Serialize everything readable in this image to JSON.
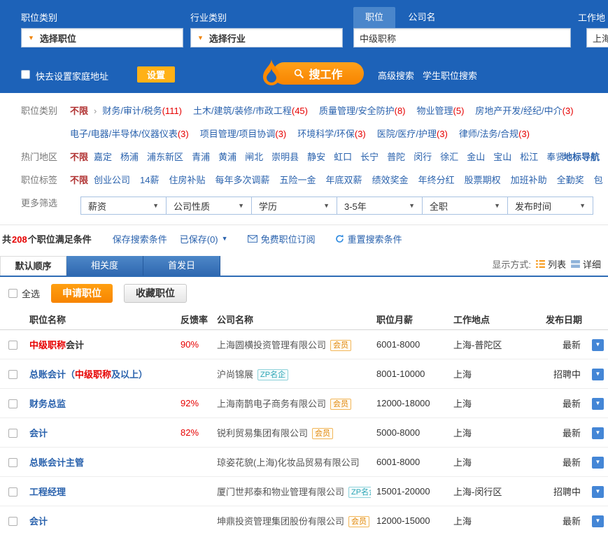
{
  "colors": {
    "header_blue": "#1d62b8",
    "accent_orange": "#ff9000",
    "highlight_red": "#e60000",
    "link_blue": "#2a62ad",
    "badge_member_orange": "#e0870a",
    "badge_zp_teal": "#2aa5b5"
  },
  "header": {
    "job_category_label": "职位类别",
    "industry_category_label": "行业类别",
    "work_location_label": "工作地",
    "job_select_text": "选择职位",
    "industry_select_text": "选择行业",
    "keyword_tabs": {
      "position": "职位",
      "company": "公司名"
    },
    "keyword_value": "中级职称",
    "location_value": "上海",
    "home_address_text": "快去设置家庭地址",
    "settings_button": "设置",
    "search_button": "搜工作",
    "advanced_search_link": "高级搜索",
    "student_search_link": "学生职位搜索"
  },
  "filters": {
    "job_category": {
      "label": "职位类别",
      "any": "不限",
      "rows": [
        [
          {
            "name": "财务/审计/税务",
            "count": "(111)"
          },
          {
            "name": "土木/建筑/装修/市政工程",
            "count": "(45)"
          },
          {
            "name": "质量管理/安全防护",
            "count": "(8)"
          },
          {
            "name": "物业管理",
            "count": "(5)"
          },
          {
            "name": "房地产开发/经纪/中介",
            "count": "(3)"
          }
        ],
        [
          {
            "name": "电子/电器/半导体/仪器仪表",
            "count": "(3)"
          },
          {
            "name": "项目管理/项目协调",
            "count": "(3)"
          },
          {
            "name": "环境科学/环保",
            "count": "(3)"
          },
          {
            "name": "医院/医疗/护理",
            "count": "(3)"
          },
          {
            "name": "律师/法务/合规",
            "count": "(3)"
          }
        ]
      ]
    },
    "hot_area": {
      "label": "热门地区",
      "any": "不限",
      "areas": [
        "嘉定",
        "杨浦",
        "浦东新区",
        "青浦",
        "黄浦",
        "闸北",
        "崇明县",
        "静安",
        "虹口",
        "长宁",
        "普陀",
        "闵行",
        "徐汇",
        "金山",
        "宝山",
        "松江",
        "奉贤"
      ],
      "landmark_link": "地标导航"
    },
    "job_tags": {
      "label": "职位标签",
      "any": "不限",
      "tags": [
        "创业公司",
        "14薪",
        "住房补贴",
        "每年多次调薪",
        "五险一金",
        "年底双薪",
        "绩效奖金",
        "年终分红",
        "股票期权",
        "加班补助",
        "全勤奖",
        "包"
      ]
    },
    "more": {
      "label": "更多筛选",
      "selects": [
        "薪资",
        "公司性质",
        "学历",
        "3-5年",
        "全职",
        "发布时间"
      ]
    }
  },
  "results_bar": {
    "count_prefix": "共",
    "count": "208",
    "count_suffix": "个职位满足条件",
    "save_link": "保存搜索条件",
    "saved_link": "已保存(0)",
    "subscribe_link": "免费职位订阅",
    "reset_link": "重置搜索条件"
  },
  "sort_tabs": {
    "tabs": [
      "默认顺序",
      "相关度",
      "首发日"
    ],
    "display_label": "显示方式:",
    "list_label": "列表",
    "detail_label": "详细"
  },
  "actions": {
    "select_all": "全选",
    "apply_button": "申请职位",
    "favorite_button": "收藏职位"
  },
  "table": {
    "columns": [
      "职位名称",
      "反馈率",
      "公司名称",
      "职位月薪",
      "工作地点",
      "发布日期"
    ],
    "rows": [
      {
        "title_parts": [
          {
            "text": "中级职称",
            "style": "highlight"
          },
          {
            "text": "会计",
            "style": "dark"
          }
        ],
        "feedback": "90%",
        "company": "上海圆横投资管理有限公司",
        "badge": {
          "text": "会员",
          "type": "member"
        },
        "salary": "6001-8000",
        "location": "上海-普陀区",
        "date": "最新"
      },
      {
        "title_parts": [
          {
            "text": "总账会计（",
            "style": "link"
          },
          {
            "text": "中级职称",
            "style": "highlight"
          },
          {
            "text": "及以上）",
            "style": "link"
          }
        ],
        "feedback": "",
        "company": "沪尚锦展",
        "badge": {
          "text": "ZP名企",
          "type": "zp"
        },
        "salary": "8001-10000",
        "location": "上海",
        "date": "招聘中"
      },
      {
        "title_parts": [
          {
            "text": "财务总监",
            "style": "link"
          }
        ],
        "feedback": "92%",
        "company": "上海南鹊电子商务有限公司",
        "badge": {
          "text": "会员",
          "type": "member"
        },
        "salary": "12000-18000",
        "location": "上海",
        "date": "最新"
      },
      {
        "title_parts": [
          {
            "text": "会计",
            "style": "link"
          }
        ],
        "feedback": "82%",
        "company": "锐利贸易集团有限公司",
        "badge": {
          "text": "会员",
          "type": "member"
        },
        "salary": "5000-8000",
        "location": "上海",
        "date": "最新"
      },
      {
        "title_parts": [
          {
            "text": "总账会计主管",
            "style": "link"
          }
        ],
        "feedback": "",
        "company": "琼姿花貌(上海)化妆品贸易有限公司",
        "badge": null,
        "salary": "6001-8000",
        "location": "上海",
        "date": "最新"
      },
      {
        "title_parts": [
          {
            "text": "工程经理",
            "style": "link"
          }
        ],
        "feedback": "",
        "company": "厦门世邦泰和物业管理有限公司",
        "badge": {
          "text": "ZP名企",
          "type": "zp"
        },
        "salary": "15001-20000",
        "location": "上海-闵行区",
        "date": "招聘中"
      },
      {
        "title_parts": [
          {
            "text": "会计",
            "style": "link"
          }
        ],
        "feedback": "",
        "company": "坤鼎投资管理集团股份有限公司",
        "badge": {
          "text": "会员",
          "type": "member"
        },
        "salary": "12000-15000",
        "location": "上海",
        "date": "最新"
      }
    ]
  }
}
